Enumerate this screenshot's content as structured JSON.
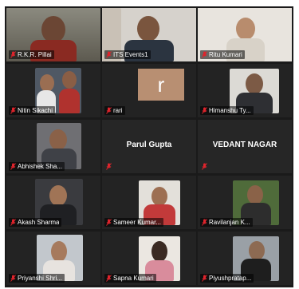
{
  "participants": [
    {
      "name": "R.K.R. Pillai",
      "muted": true,
      "active_speaker": true
    },
    {
      "name": "ITS Events1",
      "muted": true
    },
    {
      "name": "Ritu Kumari",
      "muted": true
    },
    {
      "name": "Nitin Sikachi",
      "muted": true
    },
    {
      "name": "rari",
      "muted": true,
      "avatar_letter": "r",
      "avatar_color": "#b88f72"
    },
    {
      "name": "Himanshu Ty...",
      "muted": true
    },
    {
      "name": "Abhishek Sha...",
      "muted": true
    },
    {
      "name": "Parul Gupta",
      "muted": true,
      "video_off": true
    },
    {
      "name": "VEDANT NAGAR",
      "muted": true,
      "video_off": true
    },
    {
      "name": "Akash Sharma",
      "muted": true
    },
    {
      "name": "Sameer Kumar...",
      "muted": true
    },
    {
      "name": "Ravilanjan K...",
      "muted": true
    },
    {
      "name": "Priyanshi Shri...",
      "muted": true
    },
    {
      "name": "Sapna Kumari",
      "muted": true
    },
    {
      "name": "Piyushpratap...",
      "muted": true
    }
  ],
  "colors": {
    "active_border": "#c7e34a",
    "muted_icon": "#e0242c",
    "tile_bg": "#262626"
  }
}
